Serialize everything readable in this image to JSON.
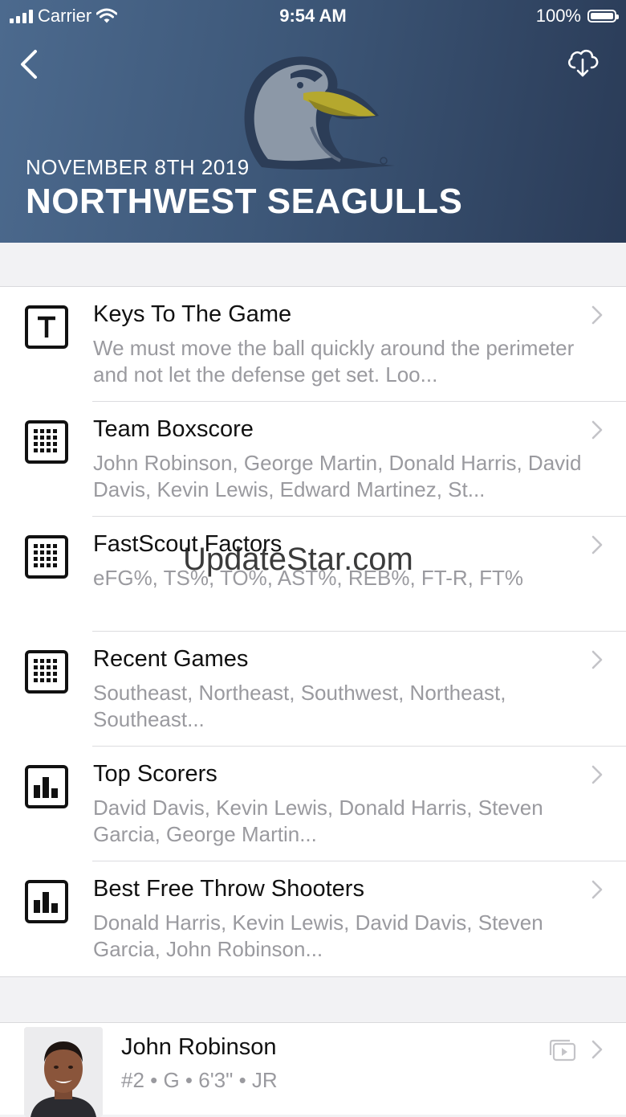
{
  "status_bar": {
    "carrier": "Carrier",
    "time": "9:54 AM",
    "battery_text": "100%",
    "battery_level": 1.0
  },
  "header": {
    "date": "NOVEMBER 8TH 2019",
    "team": "NORTHWEST SEAGULLS",
    "logo": "seagull-logo",
    "back_icon": "chevron-left-icon",
    "download_icon": "cloud-download-icon"
  },
  "menu": [
    {
      "icon": "text-t-icon",
      "title": "Keys To The Game",
      "subtitle": "We must move the ball quickly around the perimeter and not let the defense get set. Loo..."
    },
    {
      "icon": "grid-icon",
      "title": "Team Boxscore",
      "subtitle": "John Robinson, George Martin, Donald Harris, David Davis, Kevin Lewis, Edward Martinez, St..."
    },
    {
      "icon": "grid-icon",
      "title": "FastScout Factors",
      "subtitle": "eFG%, TS%, TO%, AST%, REB%, FT-R, FT%"
    },
    {
      "icon": "grid-icon",
      "title": "Recent Games",
      "subtitle": "Southeast, Northeast, Southwest, Northeast, Southeast..."
    },
    {
      "icon": "bar-chart-icon",
      "title": "Top Scorers",
      "subtitle": "David Davis, Kevin Lewis, Donald Harris, Steven Garcia, George Martin..."
    },
    {
      "icon": "bar-chart-icon",
      "title": "Best Free Throw Shooters",
      "subtitle": "Donald Harris, Kevin Lewis, David Davis, Steven Garcia, John Robinson..."
    }
  ],
  "watermark": "UpdateStar.com",
  "player": {
    "name": "John Robinson",
    "meta": "#2 • G • 6'3\" • JR",
    "video_icon": "video-library-icon"
  },
  "colors": {
    "header_start": "#4c6a8e",
    "header_end": "#2a3b57",
    "subtitle_gray": "#9a9a9f",
    "logo_beak": "#b5a82e"
  }
}
